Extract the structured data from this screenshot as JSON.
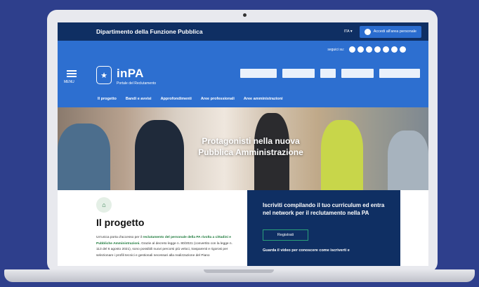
{
  "topbar": {
    "department": "Dipartimento della Funzione Pubblica",
    "language": "ITA ▾",
    "access_label": "Accedi all'area personale"
  },
  "header": {
    "follow_label": "seguici su:",
    "social_icons": [
      "facebook-icon",
      "twitter-icon",
      "instagram-icon",
      "youtube-icon",
      "linkedin-icon",
      "telegram-icon",
      "spotify-icon"
    ],
    "menu_label": "MENU",
    "brand": "inPA",
    "brand_subtitle": "Portale del Reclutamento",
    "partner_logos": [
      "unione-europea-logo",
      "italia-domani-logo",
      "pon-logo",
      "poc-logo",
      "finanziato-ue-logo"
    ]
  },
  "nav": [
    "Il progetto",
    "Bandi e avvisi",
    "Approfondimenti",
    "Aree professionali",
    "Aree amministrazioni"
  ],
  "hero": {
    "title_line1": "Protagonisti nella nuova",
    "title_line2": "Pubblica Amministrazione"
  },
  "progetto": {
    "heading": "Il progetto",
    "text_part1": "Un'unica porta d'accesso per il ",
    "text_highlight": "reclutamento del personale della PA rivolta a cittadini e Pubbliche Amministrazioni.",
    "text_part2": " Grazie al decreto legge n. 80/2021 (convertito con la legge n. 113 del 6 agosto 2021), sono possibili nuovi percorsi più veloci, trasparenti e rigorosi per selezionare i profili tecnici e gestionali necessari alla realizzazione del Piano"
  },
  "cta": {
    "text": "Iscriviti compilando il tuo curriculum ed entra nel network per il reclutamento nella PA",
    "register_label": "Registrati",
    "video_text": "Guarda il video per conoscere come iscriverti e"
  },
  "colors": {
    "navy": "#0f2f63",
    "blue": "#2d6fd0",
    "green": "#1d7a3b"
  }
}
